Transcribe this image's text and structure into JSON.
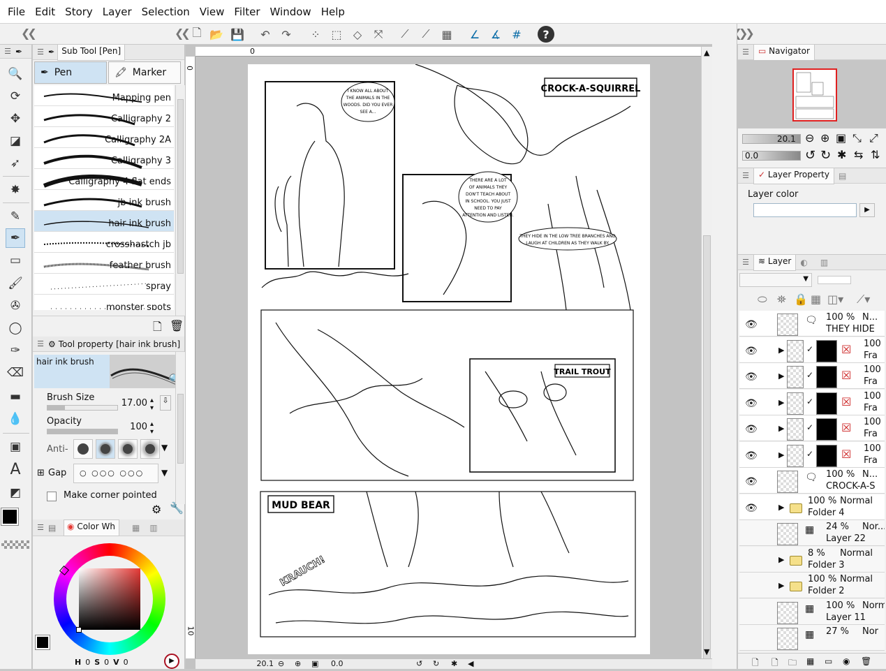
{
  "menu": [
    "File",
    "Edit",
    "Story",
    "Layer",
    "Selection",
    "View",
    "Filter",
    "Window",
    "Help"
  ],
  "toolbar": {
    "help_glyph": "?"
  },
  "subtool": {
    "title": "Sub Tool [Pen]",
    "groups": [
      {
        "label": "Pen",
        "selected": true
      },
      {
        "label": "Marker",
        "selected": false
      }
    ],
    "brushes": [
      {
        "name": "Mapping pen",
        "selected": false
      },
      {
        "name": "Calligraphy 2",
        "selected": false
      },
      {
        "name": "Calligraphy 2A",
        "selected": false
      },
      {
        "name": "Calligraphy 3",
        "selected": false
      },
      {
        "name": "Calligraphy 4 flat ends",
        "selected": false
      },
      {
        "name": "jb ink brush",
        "selected": false
      },
      {
        "name": "hair ink brush",
        "selected": true
      },
      {
        "name": "crosshastch jb",
        "selected": false
      },
      {
        "name": "feather brush",
        "selected": false
      },
      {
        "name": "spray",
        "selected": false
      },
      {
        "name": "monster spots",
        "selected": false
      }
    ]
  },
  "toolprop": {
    "title": "Tool property [hair ink brush]",
    "preview_name": "hair ink brush",
    "brush_size_label": "Brush Size",
    "brush_size_value": "17.00",
    "brush_size_fraction": 0.25,
    "opacity_label": "Opacity",
    "opacity_value": "100",
    "opacity_fraction": 1.0,
    "anti_label": "Anti-",
    "gap_label": "Gap",
    "corner_label": "Make corner pointed"
  },
  "colorpanel": {
    "tab_label": "Color Wh",
    "h_label": "H",
    "h_value": "0",
    "s_label": "S",
    "s_value": "0",
    "v_label": "V",
    "v_value": "0",
    "accent": "#e53935"
  },
  "ruler": {
    "top_zero": "0",
    "left_zero": "0",
    "left_ten": "10"
  },
  "status": {
    "zoom": "20.1",
    "angle": "0.0"
  },
  "navigator": {
    "title": "Navigator",
    "zoom": "20.1",
    "angle": "0.0"
  },
  "layerproperty": {
    "title": "Layer Property",
    "color_label": "Layer color"
  },
  "layers": {
    "title": "Layer",
    "rows": [
      {
        "opacity": "100 %",
        "blend": "N...",
        "name": "THEY HIDE",
        "kind": "balloon",
        "eye": true
      },
      {
        "opacity": "100",
        "blend": "",
        "name": "Fra",
        "kind": "frame",
        "eye": true
      },
      {
        "opacity": "100",
        "blend": "",
        "name": "Fra",
        "kind": "frame",
        "eye": true
      },
      {
        "opacity": "100",
        "blend": "",
        "name": "Fra",
        "kind": "frame",
        "eye": true
      },
      {
        "opacity": "100",
        "blend": "",
        "name": "Fra",
        "kind": "frame",
        "eye": true
      },
      {
        "opacity": "100",
        "blend": "",
        "name": "Fra",
        "kind": "frame",
        "eye": true
      },
      {
        "opacity": "100 %",
        "blend": "N...",
        "name": "CROCK-A-S",
        "kind": "balloon",
        "eye": true
      },
      {
        "opacity": "100 %",
        "blend": "Normal",
        "name": "Folder 4",
        "kind": "folder",
        "eye": true
      },
      {
        "opacity": "24 %",
        "blend": "Nor...",
        "name": "Layer 22",
        "kind": "raster",
        "eye": false
      },
      {
        "opacity": "8 %",
        "blend": "Normal",
        "name": "Folder 3",
        "kind": "folder",
        "eye": false
      },
      {
        "opacity": "100 %",
        "blend": "Normal",
        "name": "Folder 2",
        "kind": "folder",
        "eye": false
      },
      {
        "opacity": "100 %",
        "blend": "Normal",
        "name": "Layer 11",
        "kind": "raster",
        "eye": false
      },
      {
        "opacity": "27 %",
        "blend": "Nor",
        "name": "",
        "kind": "raster",
        "eye": false
      }
    ]
  },
  "comic": {
    "caption1": "CROCK-A-SQUIRREL",
    "caption2": "TRAIL TROUT",
    "caption3": "MUD BEAR",
    "balloon1": [
      "I KNOW ALL ABOUT",
      "THE ANIMALS IN THE",
      "WOODS. DID YOU EVER",
      "SEE A..."
    ],
    "balloon2": [
      "THERE ARE A LOT",
      "OF ANIMALS THEY",
      "DON'T TEACH ABOUT",
      "IN SCHOOL. YOU JUST",
      "NEED TO PAY",
      "ATTENTION AND LISTEN."
    ],
    "balloon3": [
      "THEY HIDE IN THE LOW TREE BRANCHES AND",
      "LAUGH AT CHILDREN AS THEY WALK BY."
    ],
    "sfx": "KRAUCH!"
  }
}
